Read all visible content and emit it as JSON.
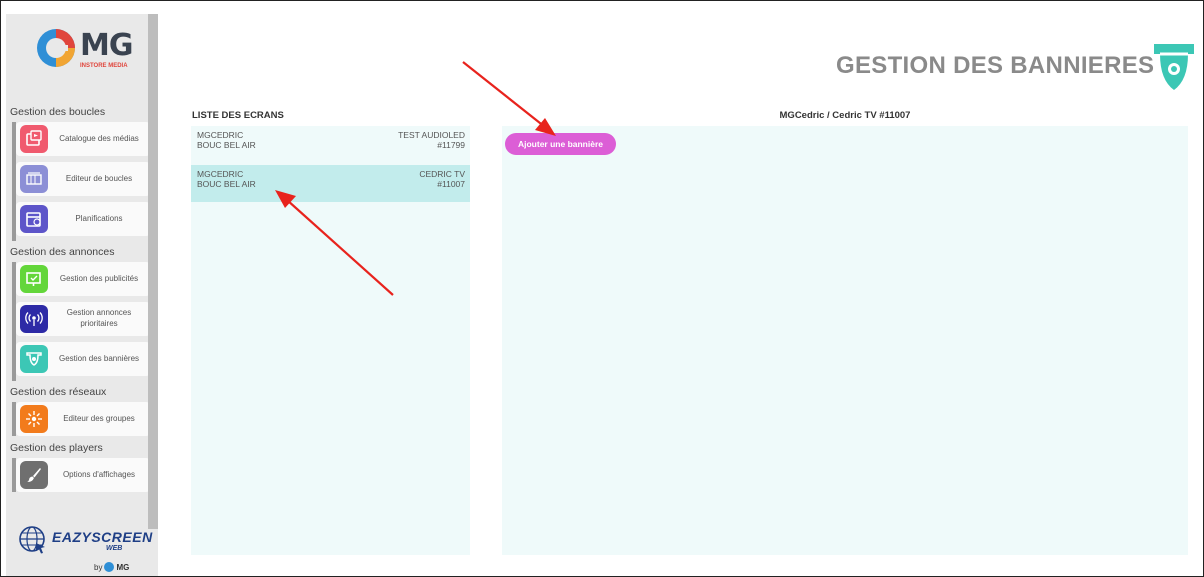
{
  "logo": {
    "text": "MG",
    "subtitle": "INSTORE MEDIA"
  },
  "sidebar": {
    "sections": [
      {
        "title": "Gestion des boucles"
      },
      {
        "title": "Gestion des annonces"
      },
      {
        "title": "Gestion des réseaux"
      },
      {
        "title": "Gestion des players"
      }
    ],
    "items": [
      {
        "label": "Catalogue des médias",
        "icon": "media-catalog-icon",
        "color": "#f05a6e"
      },
      {
        "label": "Editeur de boucles",
        "icon": "loop-editor-icon",
        "color": "#8c8fd6"
      },
      {
        "label": "Planifications",
        "icon": "calendar-icon",
        "color": "#5d55c9"
      },
      {
        "label": "Gestion des publicités",
        "icon": "ad-screen-icon",
        "color": "#63d63a"
      },
      {
        "label": "Gestion annonces prioritaires",
        "icon": "broadcast-icon",
        "color": "#2d2aa6"
      },
      {
        "label": "Gestion des bannières",
        "icon": "banner-icon",
        "color": "#3cc7b5"
      },
      {
        "label": "Editeur des groupes",
        "icon": "network-icon",
        "color": "#f27b1c"
      },
      {
        "label": "Options d'affichages",
        "icon": "brush-icon",
        "color": "#6f6f6f"
      }
    ]
  },
  "brand": {
    "name": "EAZYSCREEN",
    "suffix": "WEB",
    "by": "by",
    "by_logo": "MG"
  },
  "header": {
    "title": "GESTION DES BANNIERES",
    "icon": "banner-icon",
    "icon_color": "#3cc7b5"
  },
  "screens": {
    "heading": "LISTE DES ECRANS",
    "rows": [
      {
        "client": "MGCEDRIC",
        "site": "BOUC BEL AIR",
        "name": "TEST AUDIOLED",
        "id": "#11799",
        "selected": false
      },
      {
        "client": "MGCEDRIC",
        "site": "BOUC BEL AIR",
        "name": "CEDRIC TV",
        "id": "#11007",
        "selected": true
      }
    ]
  },
  "detail": {
    "heading": "MGCedric / Cedric TV #11007",
    "add_button_label": "Ajouter une bannière"
  },
  "colors": {
    "accent": "#dc5ed6",
    "selected_row": "#c2ecec",
    "panel_bg": "#effafa",
    "arrow": "#e8231d"
  }
}
